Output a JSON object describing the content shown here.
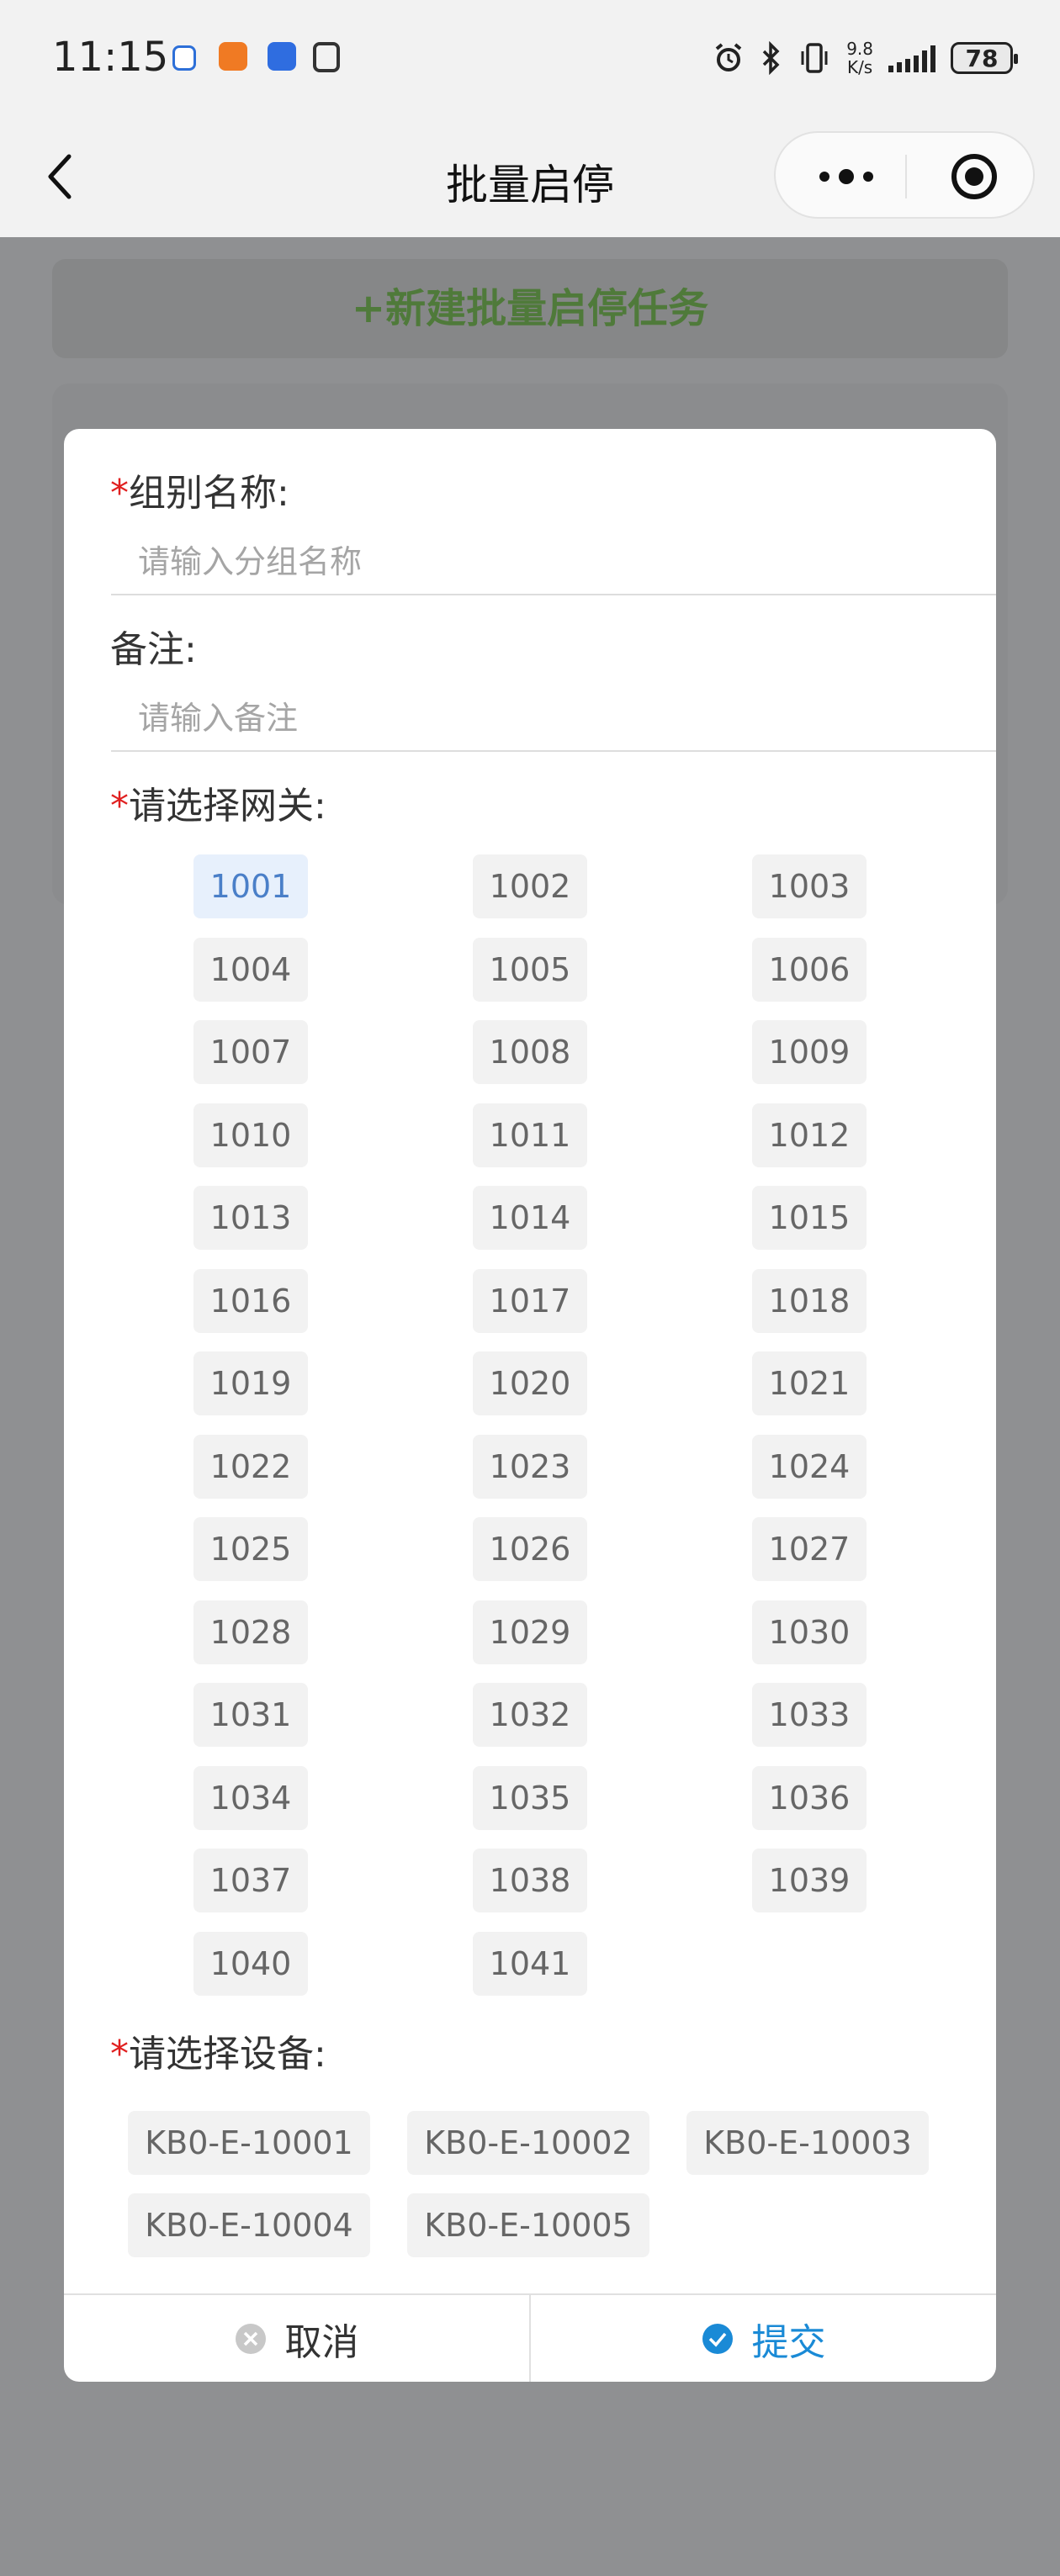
{
  "status_bar": {
    "time": "11:15",
    "net_speed_value": "9.8",
    "net_speed_unit": "K/s",
    "battery": "78"
  },
  "nav": {
    "title": "批量启停"
  },
  "background": {
    "new_task_button": "+新建批量启停任务"
  },
  "form": {
    "group_name_label": "组别名称:",
    "group_name_placeholder": "请输入分组名称",
    "remark_label": "备注:",
    "remark_placeholder": "请输入备注",
    "gateway_label": "请选择网关:",
    "device_label": "请选择设备:",
    "required_mark": "*",
    "gateways": [
      "1001",
      "1002",
      "1003",
      "1004",
      "1005",
      "1006",
      "1007",
      "1008",
      "1009",
      "1010",
      "1011",
      "1012",
      "1013",
      "1014",
      "1015",
      "1016",
      "1017",
      "1018",
      "1019",
      "1020",
      "1021",
      "1022",
      "1023",
      "1024",
      "1025",
      "1026",
      "1027",
      "1028",
      "1029",
      "1030",
      "1031",
      "1032",
      "1033",
      "1034",
      "1035",
      "1036",
      "1037",
      "1038",
      "1039",
      "1040",
      "1041"
    ],
    "selected_gateway": "1001",
    "devices": [
      "KB0-E-10001",
      "KB0-E-10002",
      "KB0-E-10003",
      "KB0-E-10004",
      "KB0-E-10005"
    ]
  },
  "footer": {
    "cancel_label": "取消",
    "submit_label": "提交"
  },
  "colors": {
    "accent": "#1a8ad6",
    "required": "#e02020",
    "selected_chip_text": "#4a7fc8",
    "overlay": "#8f9092",
    "new_task_text": "#4f7a3a"
  }
}
